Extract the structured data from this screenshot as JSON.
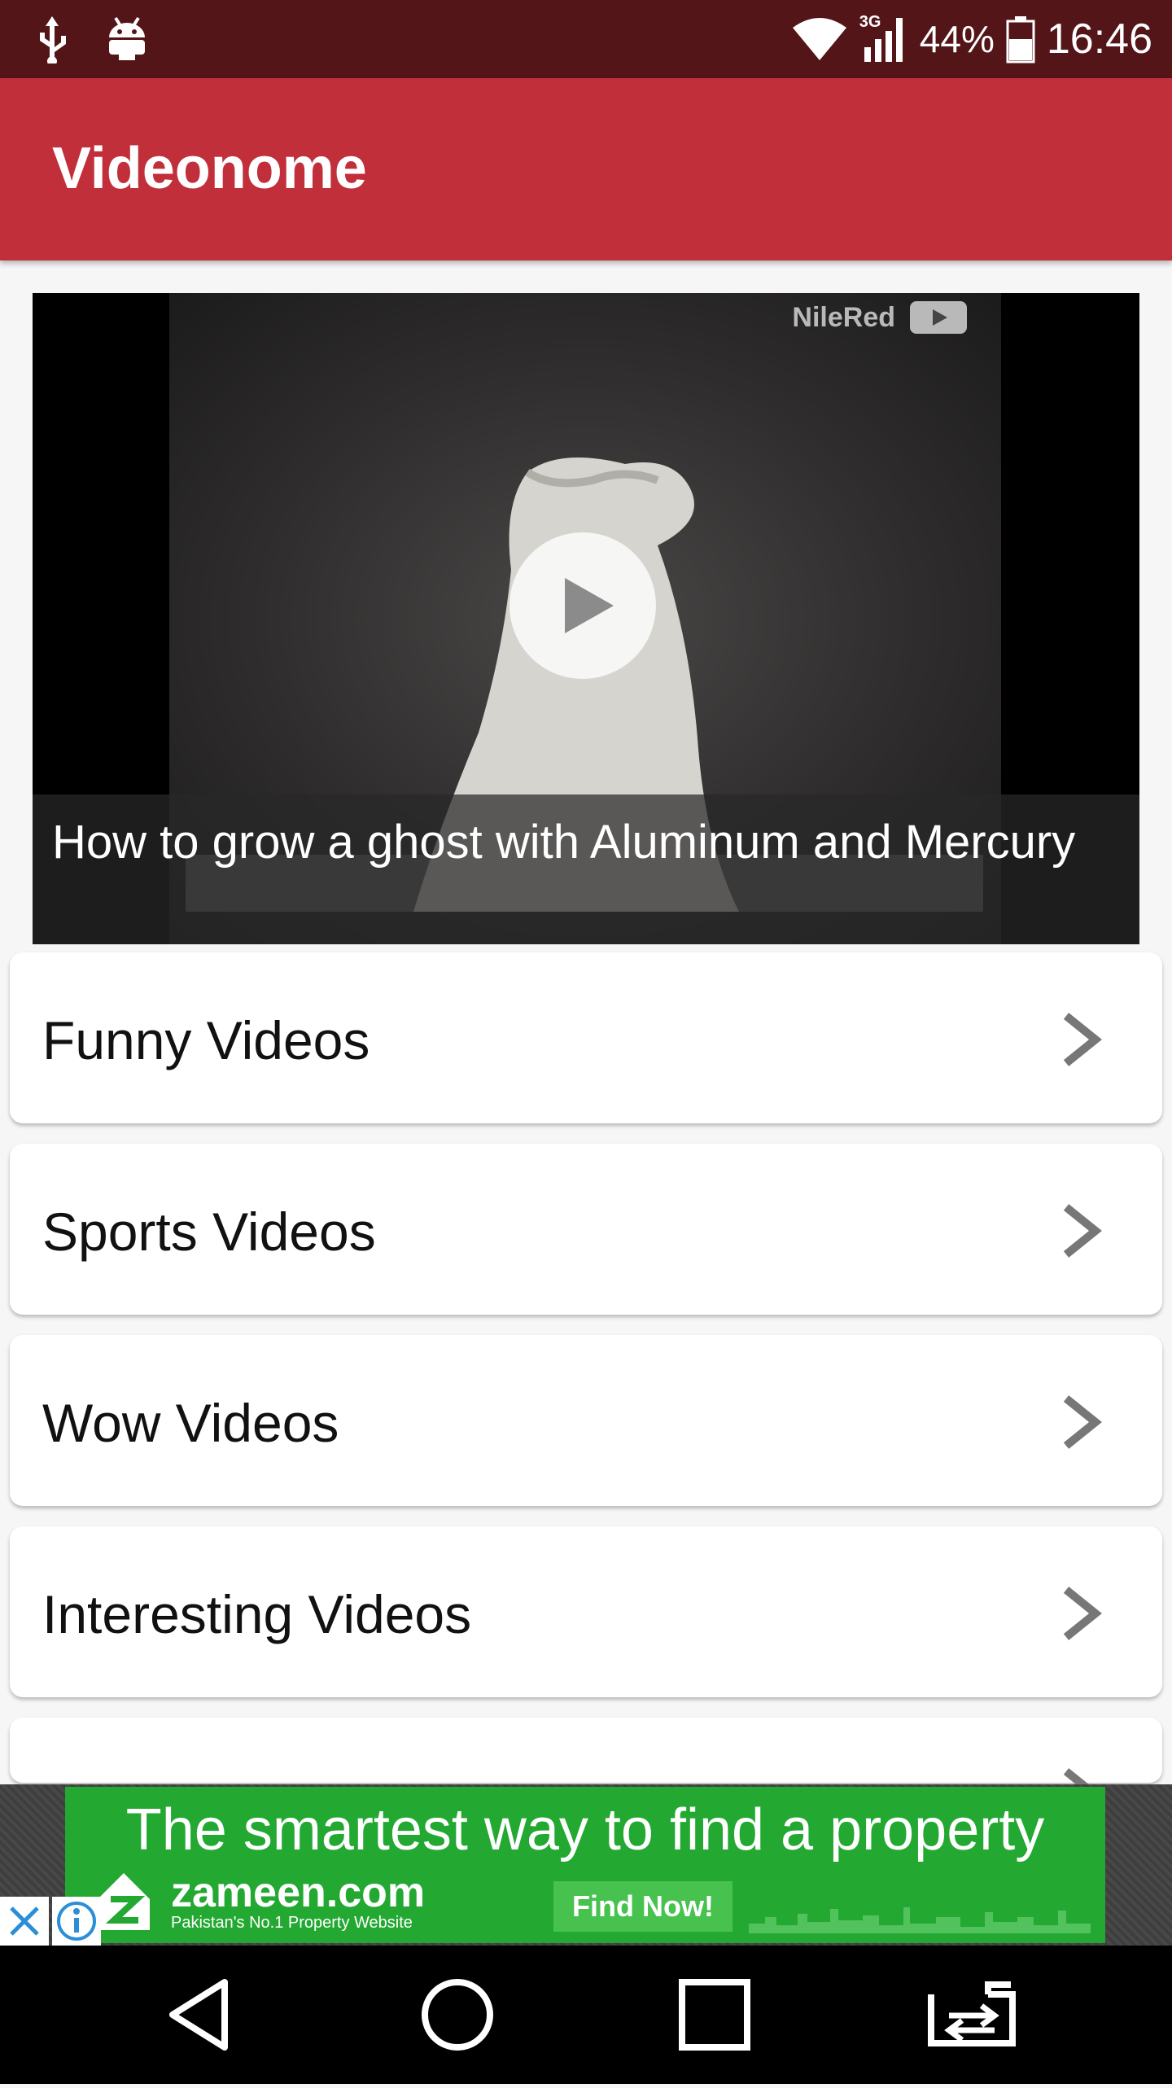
{
  "status_bar": {
    "battery_percent": "44%",
    "time": "16:46",
    "network_type": "3G",
    "icons": [
      "usb-icon",
      "android-debug-icon",
      "wifi-icon",
      "signal-icon",
      "battery-icon"
    ]
  },
  "app_bar": {
    "title": "Videonome"
  },
  "featured_video": {
    "title": "How to grow a ghost with Aluminum and Mercury",
    "channel_watermark": "NileRed"
  },
  "categories": [
    {
      "label": "Funny Videos"
    },
    {
      "label": "Sports Videos"
    },
    {
      "label": "Wow Videos"
    },
    {
      "label": "Interesting Videos"
    }
  ],
  "ad": {
    "headline": "The smartest way to find a property",
    "brand": "zameen.com",
    "tagline": "Pakistan's No.1 Property Website",
    "cta": "Find Now!",
    "accent_color": "#23a832"
  },
  "colors": {
    "status_bar": "#531518",
    "app_bar": "#c12f3b"
  }
}
